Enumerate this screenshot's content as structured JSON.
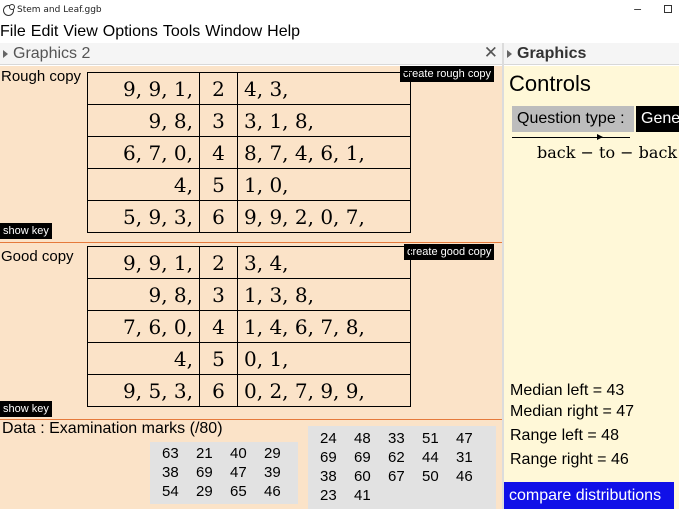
{
  "window": {
    "title": "Stem and Leaf.ggb",
    "minimize": "−"
  },
  "menu": [
    "File",
    "Edit",
    "View",
    "Options",
    "Tools",
    "Window",
    "Help"
  ],
  "left_panel": {
    "title": "Graphics 2",
    "close": "✕"
  },
  "right_panel": {
    "title": "Graphics"
  },
  "rough": {
    "label": "Rough copy",
    "button": "create rough copy",
    "show_key": "show key",
    "rows": [
      {
        "left": "9,  9,  1,",
        "stem": "2",
        "right": "4,  3,"
      },
      {
        "left": "9,  8,",
        "stem": "3",
        "right": "3,  1,  8,"
      },
      {
        "left": "6,  7,  0,",
        "stem": "4",
        "right": "8,  7,  4,  6,  1,"
      },
      {
        "left": "4,",
        "stem": "5",
        "right": "1,  0,"
      },
      {
        "left": "5,  9,  3,",
        "stem": "6",
        "right": "9,  9,  2,  0,  7,"
      }
    ]
  },
  "good": {
    "label": "Good copy",
    "button": "create good copy",
    "show_key": "show key",
    "rows": [
      {
        "left": "9,  9,  1,",
        "stem": "2",
        "right": "3,  4,"
      },
      {
        "left": "9,  8,",
        "stem": "3",
        "right": "1,  3,  8,"
      },
      {
        "left": "7,  6,  0,",
        "stem": "4",
        "right": "1,  4,  6,  7,  8,"
      },
      {
        "left": "4,",
        "stem": "5",
        "right": "0,  1,"
      },
      {
        "left": "9,  5,  3,",
        "stem": "6",
        "right": "0,  2,  7,  9,  9,"
      }
    ]
  },
  "data": {
    "title": "Data :  Examination marks (/80)",
    "left_set": [
      [
        "63",
        "21",
        "40",
        "29"
      ],
      [
        "38",
        "69",
        "47",
        "39"
      ],
      [
        "54",
        "29",
        "65",
        "46"
      ]
    ],
    "right_set": [
      [
        "24",
        "48",
        "33",
        "51",
        "47"
      ],
      [
        "69",
        "69",
        "62",
        "44",
        "31"
      ],
      [
        "38",
        "60",
        "67",
        "50",
        "46"
      ],
      [
        "23",
        "41"
      ]
    ]
  },
  "controls": {
    "title": "Controls",
    "question_type_label": "Question type :",
    "question_type_value": "Gene",
    "direction": "back − to − back",
    "median_left": "Median left  = 43",
    "median_right": "Median right  = 47",
    "range_left": "Range left  = 48",
    "range_right": "Range right  = 46",
    "compare_button": "compare distributions"
  }
}
